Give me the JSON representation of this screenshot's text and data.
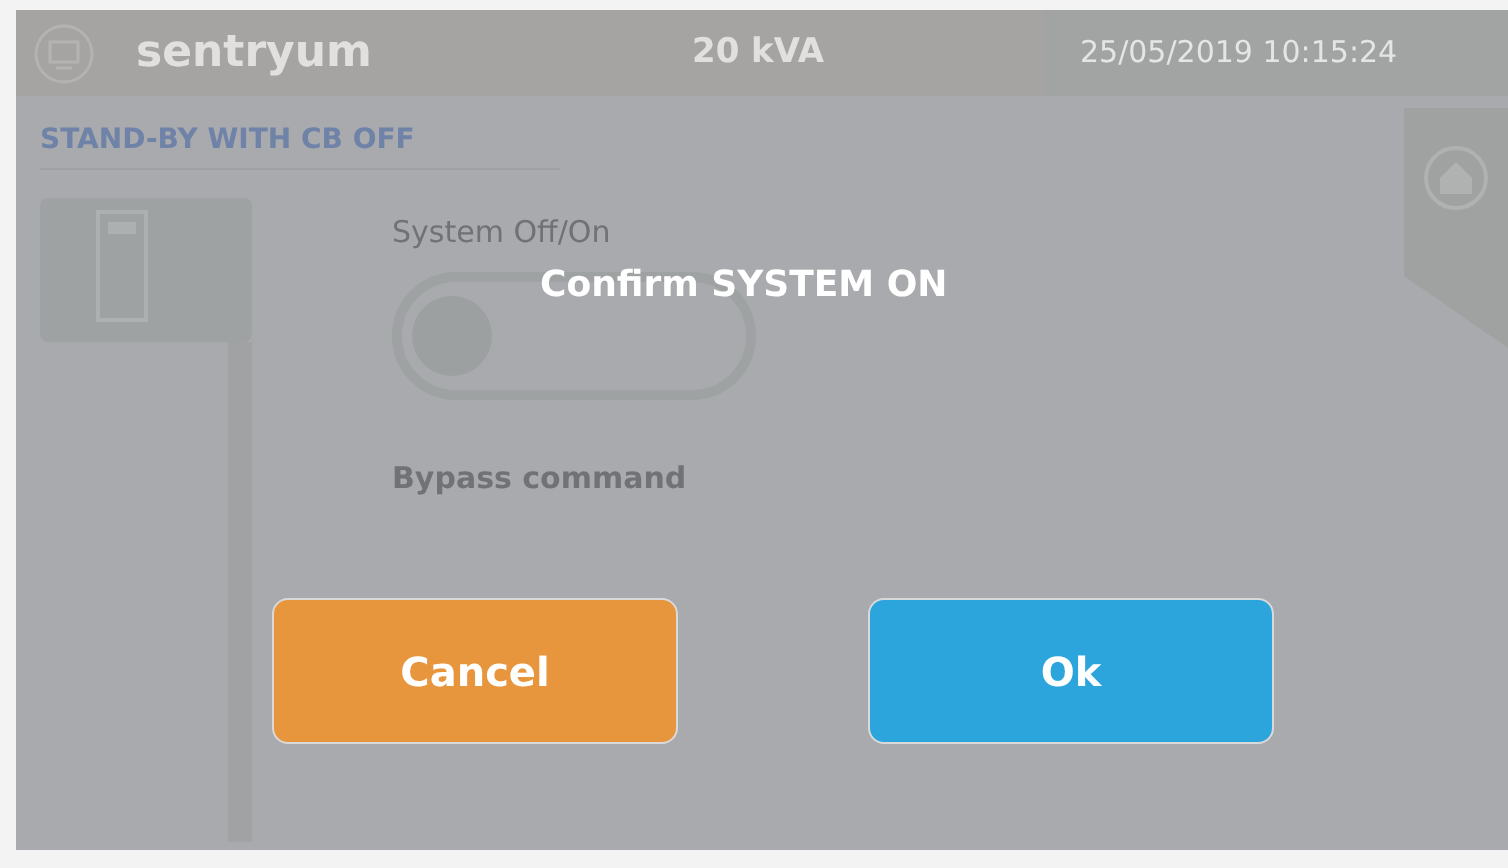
{
  "header": {
    "brand": "sentryum",
    "rating": "20 kVA",
    "datetime": "25/05/2019 10:15:24"
  },
  "status": "STAND-BY WITH CB OFF",
  "controls": {
    "system_label": "System Off/On",
    "system_toggle": {
      "on": false
    },
    "bypass_label": "Bypass command"
  },
  "dialog": {
    "title": "Confirm SYSTEM ON",
    "buttons": [
      {
        "label": "Cancel",
        "kind": "cancel"
      },
      {
        "label": "Ok",
        "kind": "ok"
      }
    ]
  }
}
